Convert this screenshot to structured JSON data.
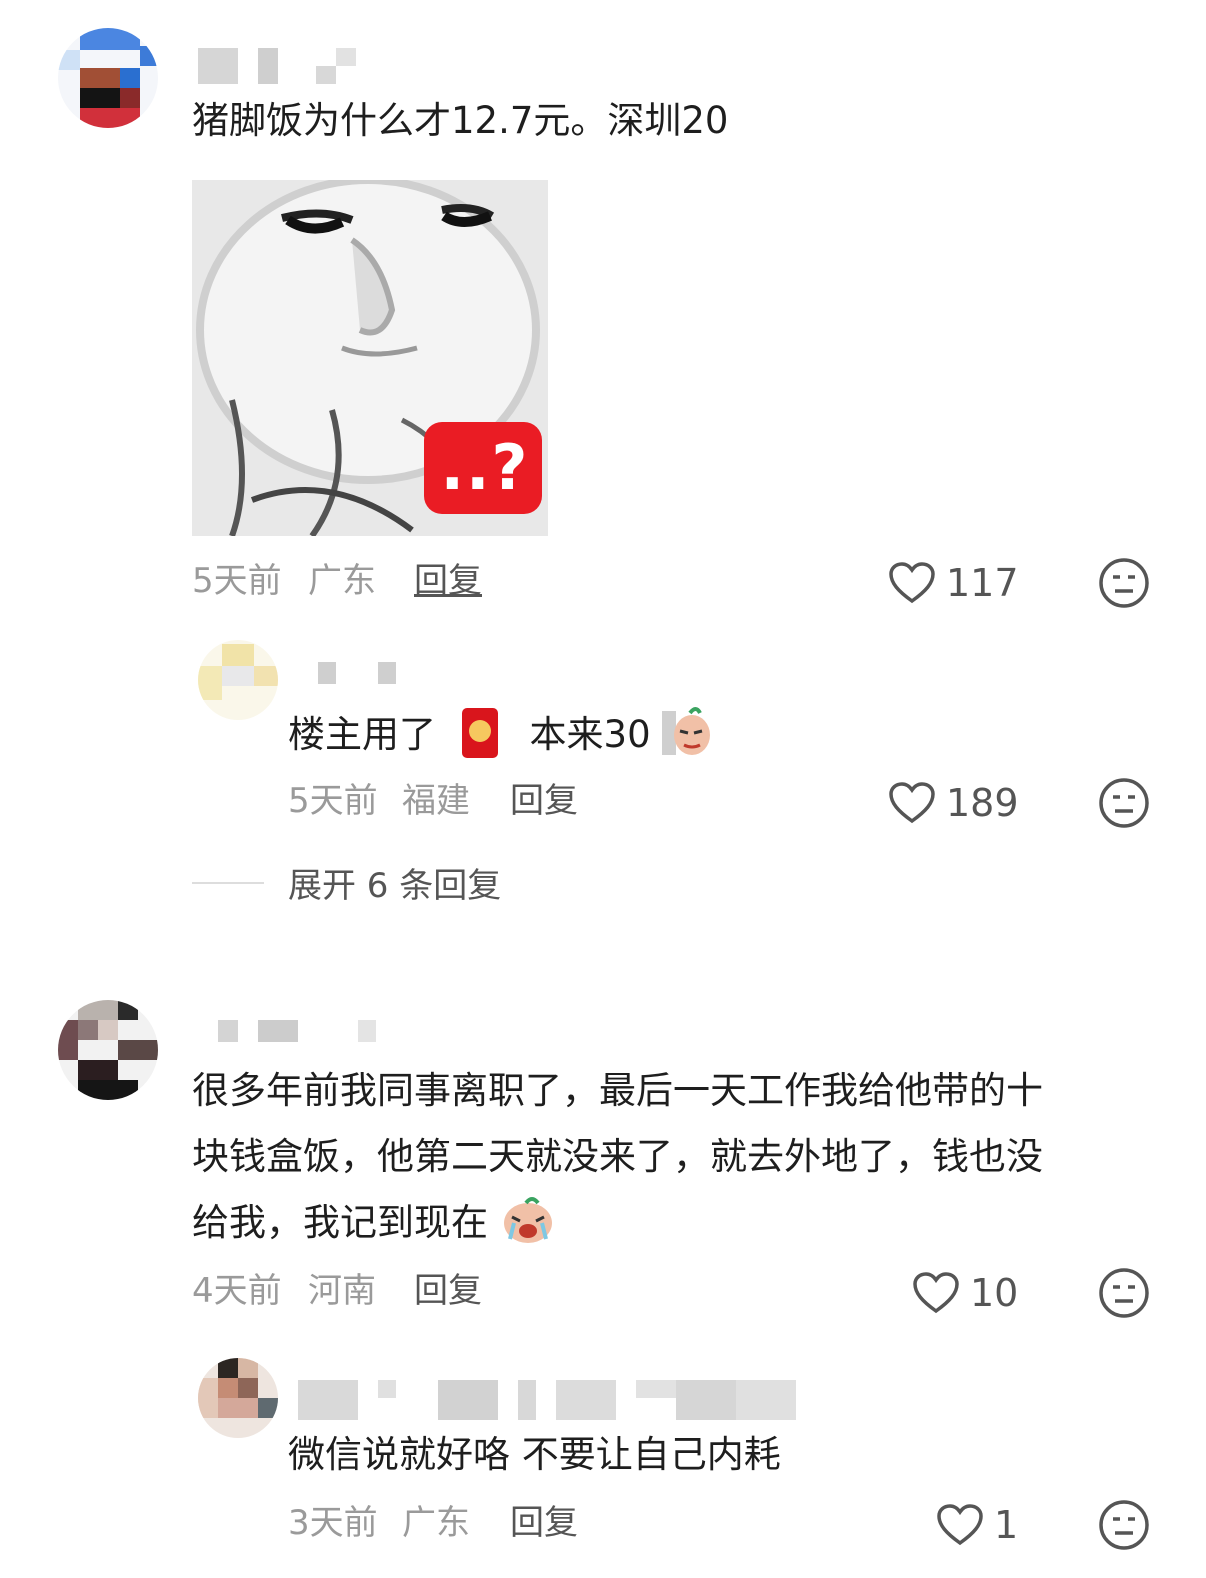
{
  "comments": [
    {
      "text": "猪脚饭为什么才12.7元。深圳20",
      "time": "5天前",
      "location": "广东",
      "reply_label": "回复",
      "likes": "117",
      "meme_overlay": "..?",
      "replies": [
        {
          "text_before": "楼主用了",
          "text_after": "本来30",
          "time": "5天前",
          "location": "福建",
          "reply_label": "回复",
          "likes": "189"
        }
      ],
      "expand_label": "展开 6 条回复"
    },
    {
      "lines": [
        "很多年前我同事离职了，最后一天工作我给他带的十",
        "块钱盒饭，他第二天就没来了，就去外地了，钱也没",
        "给我，我记到现在"
      ],
      "time": "4天前",
      "location": "河南",
      "reply_label": "回复",
      "likes": "10",
      "replies": [
        {
          "text": "微信说就好咯 不要让自己内耗",
          "time": "3天前",
          "location": "广东",
          "reply_label": "回复",
          "likes": "1"
        }
      ]
    }
  ],
  "icons": {
    "like": "heart-outline-icon",
    "dislike": "neutral-face-icon",
    "red_packet": "red-envelope-emoji",
    "sticker_peek": "peeking-sticker-emoji",
    "sticker_cry": "crying-sticker-emoji"
  },
  "colors": {
    "meme_badge": "#ea1c24",
    "red_packet": "#d9151c",
    "meta_text": "#9a9a9a"
  }
}
